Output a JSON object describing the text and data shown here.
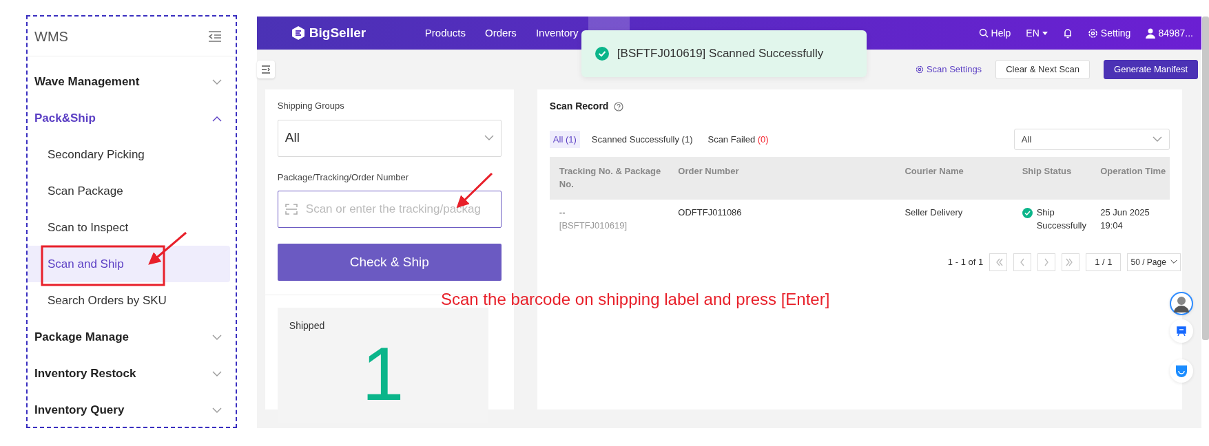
{
  "sidebar": {
    "title": "WMS",
    "items": [
      {
        "label": "Wave Management",
        "expanded": false
      },
      {
        "label": "Pack&Ship",
        "expanded": true,
        "children": [
          {
            "label": "Secondary Picking",
            "selected": false
          },
          {
            "label": "Scan Package",
            "selected": false
          },
          {
            "label": "Scan to Inspect",
            "selected": false
          },
          {
            "label": "Scan and Ship",
            "selected": true
          },
          {
            "label": "Search Orders by SKU",
            "selected": false
          }
        ]
      },
      {
        "label": "Package Manage",
        "expanded": false
      },
      {
        "label": "Inventory Restock",
        "expanded": false
      },
      {
        "label": "Inventory Query",
        "expanded": false
      }
    ]
  },
  "topbar": {
    "logo": "BigSeller",
    "nav": [
      {
        "label": "Products",
        "selected": false
      },
      {
        "label": "Orders",
        "selected": false
      },
      {
        "label": "Inventory",
        "selected": false
      }
    ],
    "help": "Help",
    "language": "EN",
    "setting": "Setting",
    "user": "84987..."
  },
  "toast": {
    "kind": "success",
    "text": "[BSFTFJ010619] Scanned Successfully"
  },
  "toolbar": {
    "scan_settings": "Scan Settings",
    "buttons": [
      {
        "label": "Clear & Next Scan",
        "kind": "outline"
      },
      {
        "label": "Generate Manifest",
        "kind": "primary"
      }
    ]
  },
  "scan_panel": {
    "groups_label": "Shipping Groups",
    "groups_value": "All",
    "number_label": "Package/Tracking/Order Number",
    "number_placeholder": "Scan or enter the tracking/packag",
    "submit": "Check & Ship",
    "stat_label": "Shipped",
    "stat_value": "1"
  },
  "scan_record": {
    "title": "Scan Record",
    "filters": [
      {
        "label": "All",
        "count": "(1)",
        "selected": true,
        "color": "#5b3fc4"
      },
      {
        "label": "Scanned Successfully",
        "count": "(1)",
        "selected": false,
        "color": "#333333"
      },
      {
        "label": "Scan Failed",
        "count": "(0)",
        "selected": false,
        "color": "#f5222d"
      }
    ],
    "status_select": "All",
    "columns": [
      "Tracking No. & Package No.",
      "Order Number",
      "Courier Name",
      "Ship Status",
      "Operation Time"
    ],
    "rows": [
      {
        "tracking": "--",
        "package": "[BSFTFJ010619]",
        "order": "ODFTFJ011086",
        "courier": "Seller Delivery",
        "status": "Ship Successfully",
        "kind": "success",
        "time": "25 Jun 2025 19:04"
      }
    ],
    "pagination": {
      "range": "1 - 1 of 1",
      "page": "1 / 1",
      "page_size": "50 / Page"
    }
  },
  "annotation": "Scan the barcode on shipping label and press [Enter]"
}
